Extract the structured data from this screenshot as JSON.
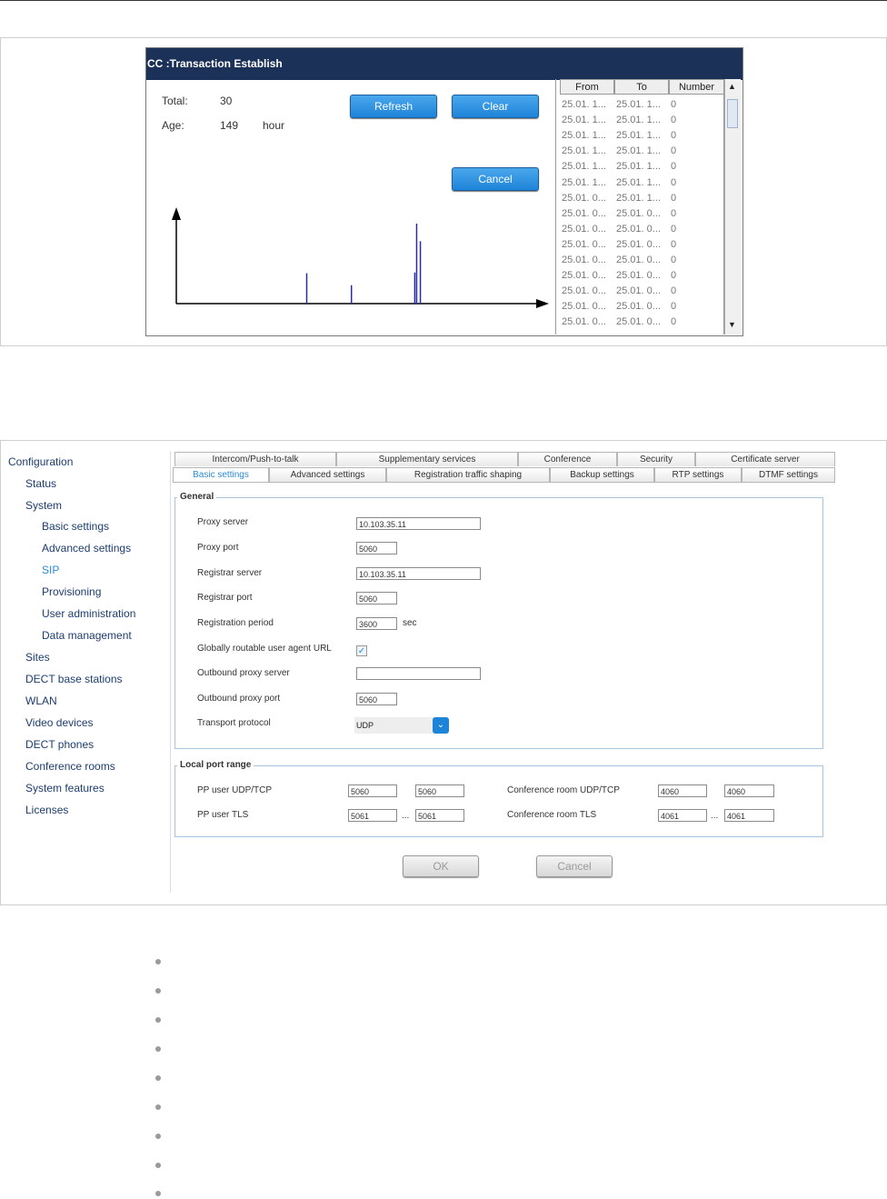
{
  "dialog": {
    "title": "CC :Transaction Establish",
    "total_label": "Total:",
    "total_value": "30",
    "age_label": "Age:",
    "age_value": "149",
    "age_unit": "hour",
    "refresh_label": "Refresh",
    "clear_label": "Clear",
    "cancel_label": "Cancel",
    "chart_data": {
      "type": "bar",
      "title": "",
      "xlabel": "",
      "ylabel": "",
      "values": [
        0.38,
        0.23,
        0.39,
        1.0,
        0.78
      ],
      "x": [
        0.35,
        0.47,
        0.64,
        0.645,
        0.655
      ]
    },
    "table": {
      "headers": [
        "From",
        "To",
        "Number"
      ],
      "rows": [
        [
          "25.01. 1...",
          "25.01. 1...",
          "0"
        ],
        [
          "25.01. 1...",
          "25.01. 1...",
          "0"
        ],
        [
          "25.01. 1...",
          "25.01. 1...",
          "0"
        ],
        [
          "25.01. 1...",
          "25.01. 1...",
          "0"
        ],
        [
          "25.01. 1...",
          "25.01. 1...",
          "0"
        ],
        [
          "25.01. 1...",
          "25.01. 1...",
          "0"
        ],
        [
          "25.01. 0...",
          "25.01. 1...",
          "0"
        ],
        [
          "25.01. 0...",
          "25.01. 0...",
          "0"
        ],
        [
          "25.01. 0...",
          "25.01. 0...",
          "0"
        ],
        [
          "25.01. 0...",
          "25.01. 0...",
          "0"
        ],
        [
          "25.01. 0...",
          "25.01. 0...",
          "0"
        ],
        [
          "25.01. 0...",
          "25.01. 0...",
          "0"
        ],
        [
          "25.01. 0...",
          "25.01. 0...",
          "0"
        ],
        [
          "25.01. 0...",
          "25.01. 0...",
          "0"
        ],
        [
          "25.01. 0...",
          "25.01. 0...",
          "0"
        ]
      ]
    }
  },
  "config": {
    "nav": [
      {
        "label": "Configuration",
        "level": 0
      },
      {
        "label": "Status",
        "level": 1
      },
      {
        "label": "System",
        "level": 1
      },
      {
        "label": "Basic settings",
        "level": 2
      },
      {
        "label": "Advanced settings",
        "level": 2
      },
      {
        "label": "SIP",
        "level": 2,
        "active": true
      },
      {
        "label": "Provisioning",
        "level": 2
      },
      {
        "label": "User administration",
        "level": 2
      },
      {
        "label": "Data management",
        "level": 2
      },
      {
        "label": "Sites",
        "level": 1
      },
      {
        "label": "DECT base stations",
        "level": 1
      },
      {
        "label": "WLAN",
        "level": 1
      },
      {
        "label": "Video devices",
        "level": 1
      },
      {
        "label": "DECT phones",
        "level": 1
      },
      {
        "label": "Conference rooms",
        "level": 1
      },
      {
        "label": "System features",
        "level": 1
      },
      {
        "label": "Licenses",
        "level": 1
      }
    ],
    "tabs_row1": [
      "Intercom/Push-to-talk",
      "Supplementary services",
      "Conference",
      "Security",
      "Certificate server"
    ],
    "tabs_row2": [
      "Basic settings",
      "Advanced settings",
      "Registration traffic shaping",
      "Backup settings",
      "RTP settings",
      "DTMF settings"
    ],
    "general": {
      "title": "General",
      "proxy_server_label": "Proxy server",
      "proxy_server_value": "10.103.35.11",
      "proxy_port_label": "Proxy port",
      "proxy_port_value": "5060",
      "registrar_server_label": "Registrar server",
      "registrar_server_value": "10.103.35.11",
      "registrar_port_label": "Registrar port",
      "registrar_port_value": "5060",
      "registration_period_label": "Registration period",
      "registration_period_value": "3600",
      "registration_period_unit": "sec",
      "globally_routable_label": "Globally routable user agent URL",
      "globally_routable_checked": "✓",
      "outbound_proxy_server_label": "Outbound proxy server",
      "outbound_proxy_server_value": "",
      "outbound_proxy_port_label": "Outbound proxy port",
      "outbound_proxy_port_value": "5060",
      "transport_protocol_label": "Transport protocol",
      "transport_protocol_value": "UDP",
      "dropdown_glyph": "⌄"
    },
    "local_port_range": {
      "title": "Local port range",
      "pp_udp_label": "PP user UDP/TCP",
      "pp_udp_from": "5060",
      "pp_udp_to": "5060",
      "pp_tls_label": "PP user TLS",
      "pp_tls_from": "5061",
      "pp_tls_to": "5061",
      "conf_udp_label": "Conference room UDP/TCP",
      "conf_udp_from": "4060",
      "conf_udp_to": "4060",
      "conf_tls_label": "Conference room TLS",
      "conf_tls_from": "4061",
      "conf_tls_to": "4061",
      "range_sep": "..."
    },
    "ok_label": "OK",
    "cancel_label": "Cancel"
  }
}
